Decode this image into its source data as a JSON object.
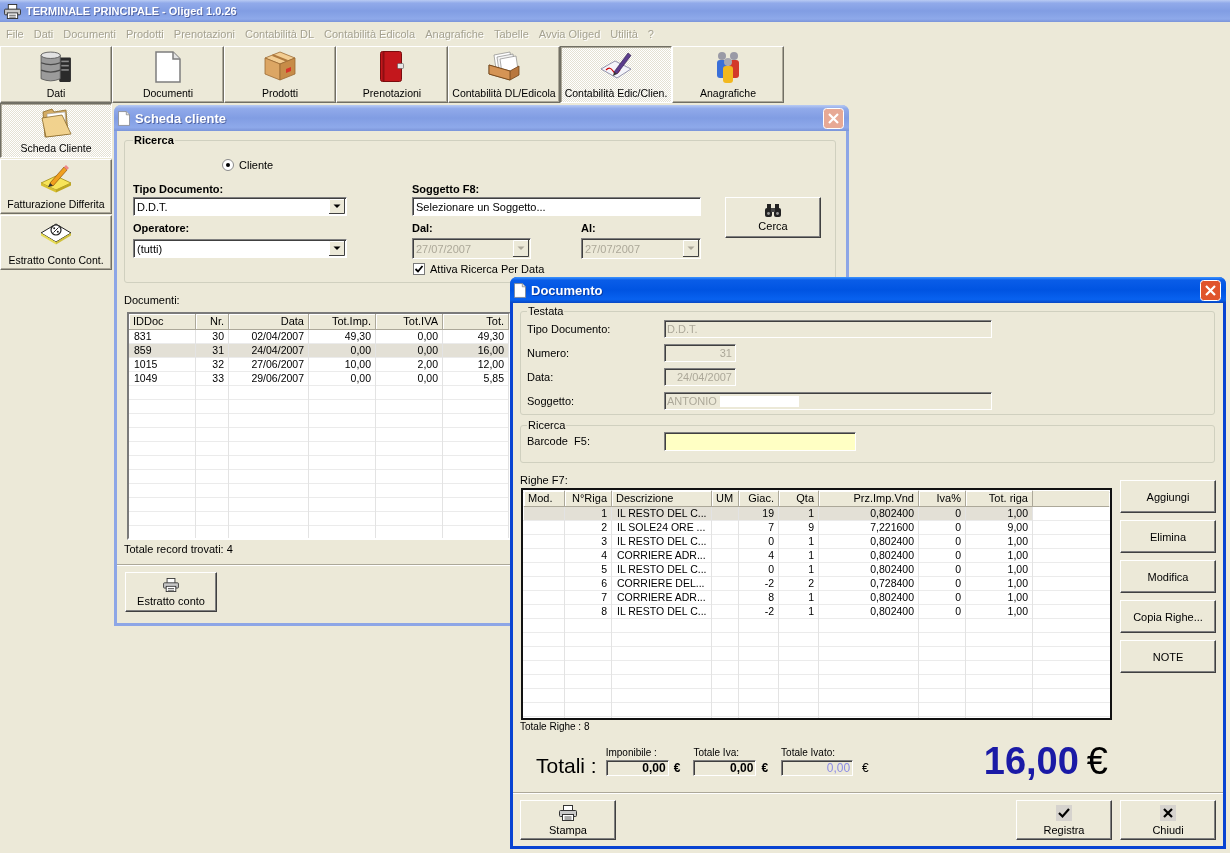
{
  "window": {
    "title": "TERMINALE PRINCIPALE - Oliged 1.0.26",
    "active": false
  },
  "menu": [
    {
      "label": "File",
      "disabled": true
    },
    {
      "label": "Dati",
      "disabled": true
    },
    {
      "label": "Documenti",
      "disabled": true
    },
    {
      "label": "Prodotti",
      "disabled": true
    },
    {
      "label": "Prenotazioni",
      "disabled": true
    },
    {
      "label": "Contabilità DL",
      "disabled": true
    },
    {
      "label": "Contabilità Edicola",
      "disabled": true
    },
    {
      "label": "Anagrafiche",
      "disabled": true
    },
    {
      "label": "Tabelle",
      "disabled": true
    },
    {
      "label": "Avvia Oliged",
      "disabled": true
    },
    {
      "label": "Utilità",
      "disabled": true
    },
    {
      "label": "?",
      "disabled": true
    }
  ],
  "toolbar": [
    {
      "label": "Dati",
      "selected": false
    },
    {
      "label": "Documenti",
      "selected": false
    },
    {
      "label": "Prodotti",
      "selected": false
    },
    {
      "label": "Prenotazioni",
      "selected": false
    },
    {
      "label": "Contabilità DL/Edicola",
      "selected": false
    },
    {
      "label": "Contabilità Edic/Clien.",
      "selected": true
    },
    {
      "label": "Anagrafiche",
      "selected": false
    }
  ],
  "sidebar": [
    {
      "label": "Scheda Cliente",
      "selected": true
    },
    {
      "label": "Fatturazione Differita",
      "selected": false
    },
    {
      "label": "Estratto Conto Cont.",
      "selected": false
    }
  ],
  "scheda_cliente": {
    "title": "Scheda cliente",
    "active": false,
    "ricerca": {
      "title": "Ricerca",
      "radio": {
        "label": "Cliente",
        "selected": true
      },
      "tipo_documento": {
        "label": "Tipo Documento:",
        "value": "D.D.T.",
        "disabled": false
      },
      "operatore": {
        "label": "Operatore:",
        "value": "(tutti)",
        "disabled": false
      },
      "soggetto": {
        "label": "Soggetto F8:",
        "value": "Selezionare un Soggetto..."
      },
      "dal": {
        "label": "Dal:",
        "value": "27/07/2007",
        "disabled": true
      },
      "al": {
        "label": "Al:",
        "value": "27/07/2007",
        "disabled": true
      },
      "attiva_ricerca_per_data": {
        "label": "Attiva Ricerca Per Data",
        "checked": true
      },
      "search_button": "Cerca"
    },
    "documenti": {
      "label": "Documenti:",
      "columns": [
        "IDDoc",
        "Nr.",
        "Data",
        "Tot.Imp.",
        "Tot.IVA",
        "Tot."
      ],
      "rows": [
        {
          "cells": [
            "831",
            "30",
            "02/04/2007",
            "49,30",
            "0,00",
            "49,30"
          ],
          "selected": false
        },
        {
          "cells": [
            "859",
            "31",
            "24/04/2007",
            "0,00",
            "0,00",
            "16,00"
          ],
          "selected": true
        },
        {
          "cells": [
            "1015",
            "32",
            "27/06/2007",
            "10,00",
            "2,00",
            "12,00"
          ],
          "selected": false
        },
        {
          "cells": [
            "1049",
            "33",
            "29/06/2007",
            "0,00",
            "0,00",
            "5,85"
          ],
          "selected": false
        }
      ]
    },
    "status": "Totale record trovati: 4",
    "buttons": [
      "Estratto conto"
    ]
  },
  "documento": {
    "title": "Documento",
    "active": true,
    "testata": {
      "title": "Testata",
      "fields": [
        {
          "label": "Tipo Documento:",
          "value": "D.D.T.",
          "disabled": true
        },
        {
          "label": "Numero:",
          "value": "31",
          "disabled": true
        },
        {
          "label": "Data:",
          "value": "24/04/2007",
          "disabled": true
        },
        {
          "label": "Soggetto:",
          "value": "ANTONIO",
          "disabled": true
        }
      ]
    },
    "ricerca": {
      "title": "Ricerca",
      "barcode": {
        "label": "Barcode  F5:"
      }
    },
    "righe": {
      "label": "Righe F7:",
      "columns": [
        "Mod.",
        "N°Riga",
        "Descrizione",
        "UM",
        "Giac.",
        "Qta",
        "Prz.Imp.Vnd",
        "Iva%",
        "Tot. riga"
      ],
      "rows": [
        {
          "n": "1",
          "descrizione": "IL RESTO DEL C...",
          "giac": "19",
          "qta": "1",
          "prezzo": "0,802400",
          "iva": "0",
          "totale": "1,00",
          "selected": true
        },
        {
          "n": "2",
          "descrizione": "IL SOLE24 ORE ...",
          "giac": "7",
          "qta": "9",
          "prezzo": "7,221600",
          "iva": "0",
          "totale": "9,00",
          "selected": false
        },
        {
          "n": "3",
          "descrizione": "IL RESTO DEL C...",
          "giac": "0",
          "qta": "1",
          "prezzo": "0,802400",
          "iva": "0",
          "totale": "1,00",
          "selected": false
        },
        {
          "n": "4",
          "descrizione": "CORRIERE ADR...",
          "giac": "4",
          "qta": "1",
          "prezzo": "0,802400",
          "iva": "0",
          "totale": "1,00",
          "selected": false
        },
        {
          "n": "5",
          "descrizione": "IL RESTO DEL C...",
          "giac": "0",
          "qta": "1",
          "prezzo": "0,802400",
          "iva": "0",
          "totale": "1,00",
          "selected": false
        },
        {
          "n": "6",
          "descrizione": "CORRIERE DEL...",
          "giac": "-2",
          "qta": "2",
          "prezzo": "0,728400",
          "iva": "0",
          "totale": "1,00",
          "selected": false
        },
        {
          "n": "7",
          "descrizione": "CORRIERE ADR...",
          "giac": "8",
          "qta": "1",
          "prezzo": "0,802400",
          "iva": "0",
          "totale": "1,00",
          "selected": false
        },
        {
          "n": "8",
          "descrizione": "IL RESTO DEL C...",
          "giac": "-2",
          "qta": "1",
          "prezzo": "0,802400",
          "iva": "0",
          "totale": "1,00",
          "selected": false
        }
      ]
    },
    "totale_righe": "Totale Righe : 8",
    "side_buttons": [
      "Aggiungi",
      "Elimina",
      "Modifica",
      "Copia Righe...",
      "NOTE"
    ],
    "totali": {
      "label": "Totali :",
      "fields": [
        {
          "label": "Imponibile :",
          "value": "0,00",
          "currency": "€",
          "disabled": false
        },
        {
          "label": "Totale Iva:",
          "value": "0,00",
          "currency": "€",
          "disabled": false
        },
        {
          "label": "Totale Ivato:",
          "value": "0,00",
          "currency": "€",
          "disabled": true
        }
      ],
      "grand_total": {
        "value": "16,00",
        "currency": "€"
      }
    },
    "footer_buttons": [
      "Stampa",
      "Registra",
      "Chiudi"
    ]
  }
}
